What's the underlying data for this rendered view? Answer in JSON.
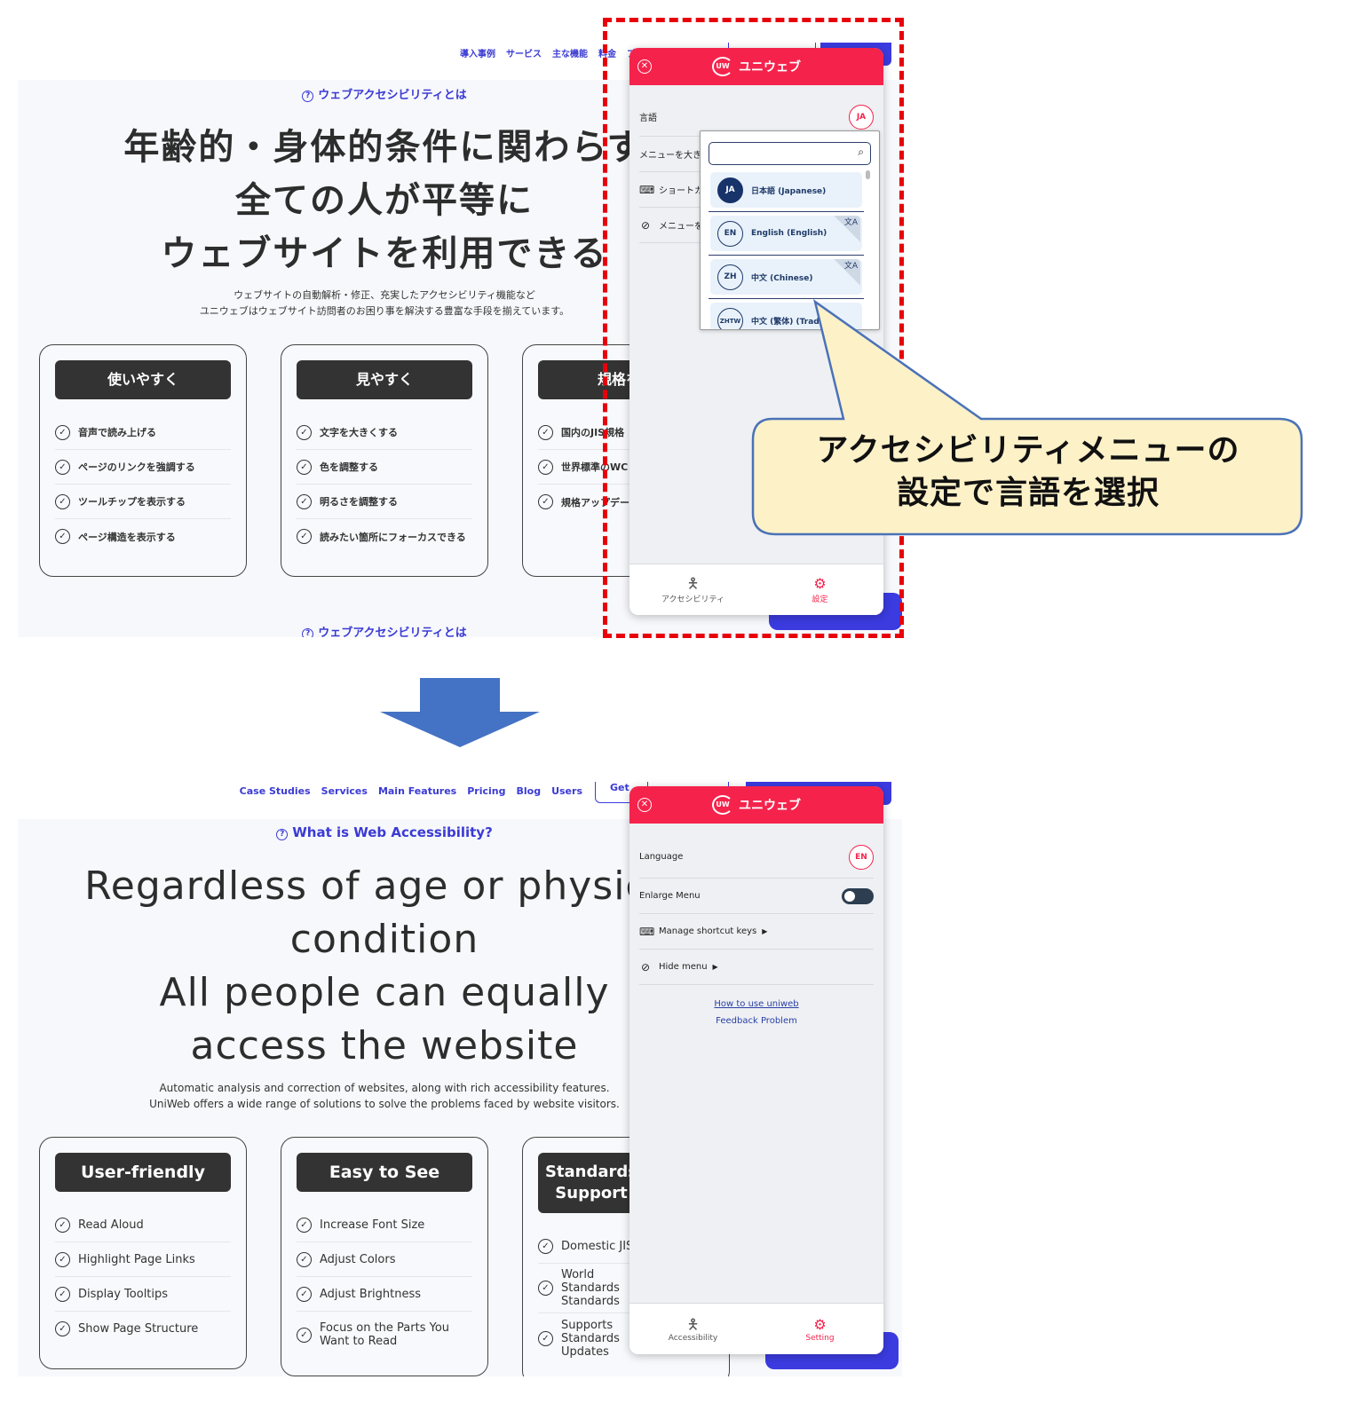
{
  "before": {
    "nav_links": [
      "導入事例",
      "サービス",
      "主な機能",
      "料金",
      "ブ"
    ],
    "eyebrow": "ウェブアクセシビリティとは",
    "hero_lines": [
      "年齢的・身体的条件に関わらず",
      "全ての人が平等に",
      "ウェブサイトを利用できる"
    ],
    "sub_lines": [
      "ウェブサイトの自動解析・修正、充実したアクセシビリティ機能など",
      "ユニウェブはウェブサイト訪問者のお困り事を解決する豊富な手段を揃えています。"
    ],
    "cards": [
      {
        "title": "使いやすく",
        "items": [
          "音声で読み上げる",
          "ページのリンクを強調する",
          "ツールチップを表示する",
          "ページ構造を表示する"
        ]
      },
      {
        "title": "見やすく",
        "items": [
          "文字を大きくする",
          "色を調整する",
          "明るさを調整する",
          "読みたい箇所にフォーカスできる"
        ]
      },
      {
        "title": "規格をサ",
        "items": [
          "国内のJIS規格",
          "世界標準のWC",
          "規格アップデー"
        ]
      }
    ],
    "eyebrow_bottom": "ウェブアクセシビリティとは",
    "widget": {
      "brand": "ユニウェブ",
      "logo_mark": "UW",
      "language_label": "言語",
      "language_code": "JA",
      "enlarge_label": "メニューを大き",
      "shortcut_label": "ショートカ",
      "hide_label": "メニューを",
      "tabs": [
        {
          "label": "アクセシビリティ",
          "icon": "accessibility-icon",
          "active": false
        },
        {
          "label": "設定",
          "icon": "gear-icon",
          "active": true
        }
      ]
    },
    "dropdown": {
      "search_value": "",
      "search_placeholder": "",
      "options": [
        {
          "code": "JA",
          "label": "日本語 (Japanese)",
          "selected": true,
          "translate_badge": false
        },
        {
          "code": "EN",
          "label": "English (English)",
          "selected": false,
          "translate_badge": true
        },
        {
          "code": "ZH",
          "label": "中文 (Chinese)",
          "selected": false,
          "translate_badge": true
        },
        {
          "code": "ZHTW",
          "label": "中文 (繁体) (Tradi",
          "selected": false,
          "translate_badge": false
        }
      ]
    }
  },
  "callout": {
    "lines": [
      "アクセシビリティメニューの",
      "設定で言語を選択"
    ],
    "fill": "#fdf1c8",
    "stroke": "#4a72b8"
  },
  "arrow_color": "#4472c4",
  "highlight_color": "#e8000b",
  "after": {
    "nav_links": [
      "Case Studies",
      "Services",
      "Main Features",
      "Pricing",
      "Blog",
      "Users"
    ],
    "nav_get": "Get",
    "eyebrow": "What is Web Accessibility?",
    "hero_lines": [
      "Regardless of age or physical",
      "condition",
      "All people can equally",
      "access the website"
    ],
    "sub_lines": [
      "Automatic analysis and correction of websites, along with rich accessibility features.",
      "UniWeb offers a wide range of solutions to solve the problems faced by website visitors."
    ],
    "cards": [
      {
        "title": "User-friendly",
        "items": [
          "Read Aloud",
          "Highlight Page Links",
          "Display Tooltips",
          "Show Page Structure"
        ]
      },
      {
        "title": "Easy to See",
        "items": [
          "Increase Font Size",
          "Adjust Colors",
          "Adjust Brightness",
          "Focus on the Parts You Want to Read"
        ]
      },
      {
        "title": "Standards Support",
        "items": [
          "Domestic JIS",
          "World Standards Standards",
          "Supports Standards Updates"
        ]
      }
    ],
    "widget": {
      "brand": "ユニウェブ",
      "logo_mark": "UW",
      "language_label": "Language",
      "language_code": "EN",
      "enlarge_label": "Enlarge Menu",
      "enlarge_on": false,
      "shortcut_label": "Manage shortcut keys",
      "hide_label": "Hide menu",
      "link_howto": "How to use uniweb",
      "link_feedback": "Feedback Problem",
      "tabs": [
        {
          "label": "Accessibility",
          "icon": "accessibility-icon",
          "active": false
        },
        {
          "label": "Setting",
          "icon": "gear-icon",
          "active": true
        }
      ]
    }
  }
}
